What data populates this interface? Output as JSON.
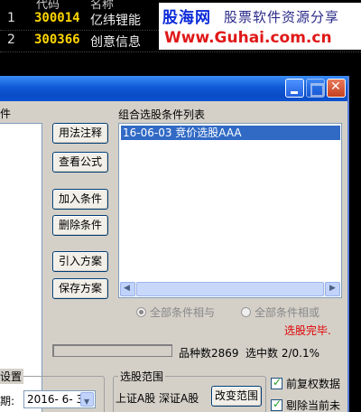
{
  "stock_list": {
    "header": {
      "code": "代码",
      "name": "名称"
    },
    "rows": [
      {
        "idx": "1",
        "code": "300014",
        "name": "亿纬锂能"
      },
      {
        "idx": "2",
        "code": "300366",
        "name": "创意信息"
      }
    ]
  },
  "watermark": {
    "brand": "股海网",
    "tagline": "股票软件资源分享",
    "url": "Www.Guhai.com.cn"
  },
  "dialog": {
    "left_panel_label": "件",
    "buttons": {
      "usage_notes": "用法注释",
      "view_formula": "查看公式",
      "add_condition": "加入条件",
      "delete_condition": "删除条件",
      "import_scheme": "引入方案",
      "save_scheme": "保存方案"
    },
    "combo_list_label": "组合选股条件列表",
    "combo_items": [
      "16-06-03 竞价选股AAA"
    ],
    "radio_and": "全部条件相与",
    "radio_or": "全部条件相或",
    "status": "选股完毕.",
    "variety_count": "品种数2869",
    "selected": "选中数 2/0.1%",
    "settings_group_label": "设置",
    "date_label": "期:",
    "date_value": "2016- 6- 3",
    "range_group_label": "选股范围",
    "range_text": "上证A股 深证A股",
    "change_range": "改变范围",
    "check_forward_adjust": "前复权数据",
    "check_exclude": "剔除当前未"
  },
  "colors": {
    "selection_blue": "#316ac5",
    "status_red": "#e00000",
    "code_yellow": "#ffd600"
  }
}
